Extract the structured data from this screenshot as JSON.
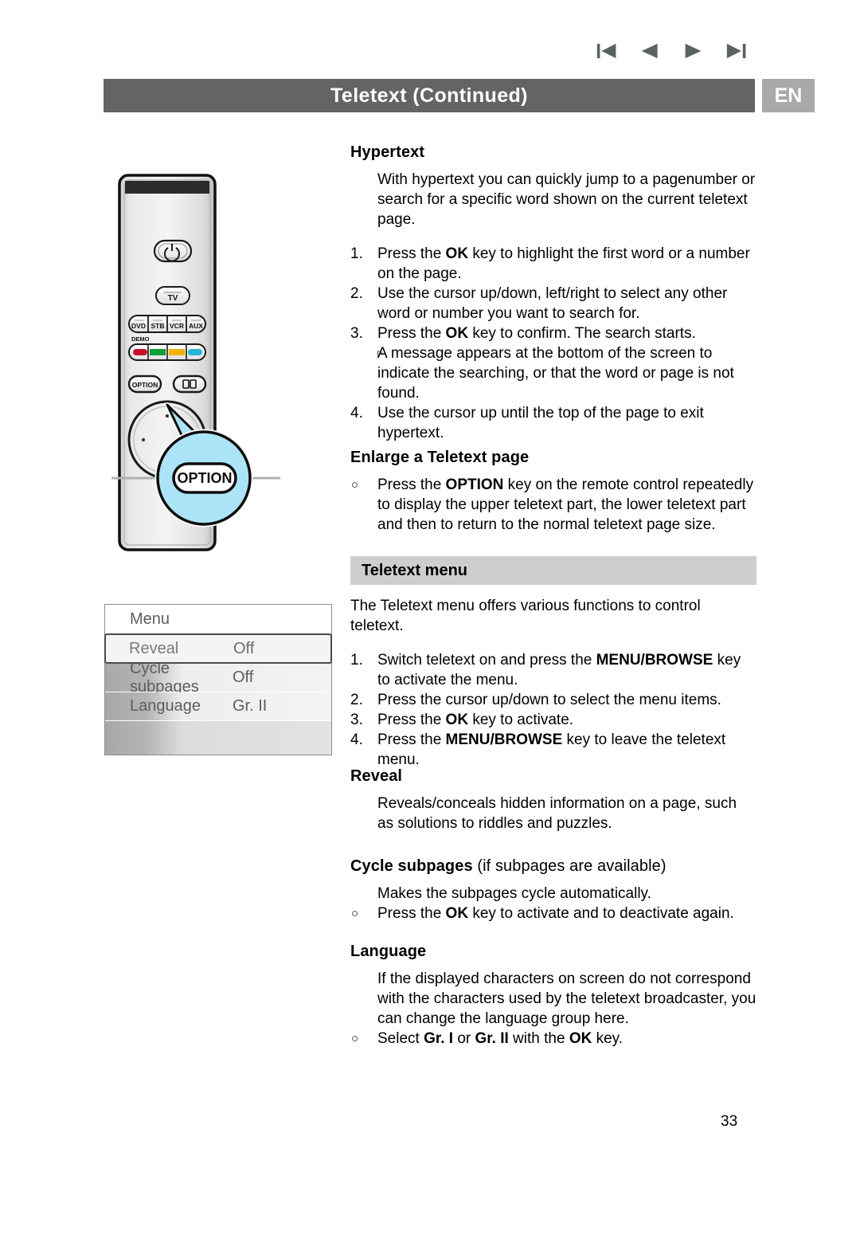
{
  "header": {
    "title": "Teletext  (Continued)",
    "language_badge": "EN",
    "nav_icons": [
      "skip-to-start-icon",
      "previous-icon",
      "next-icon",
      "skip-to-end-icon"
    ],
    "bar_color": "#646464",
    "badge_color": "#a9a9a9"
  },
  "remote": {
    "power_button": "power-icon",
    "tv_button": "TV",
    "device_buttons": [
      "DVD",
      "STB",
      "VCR",
      "AUX"
    ],
    "demo_label": "DEMO",
    "color_keys": [
      "#c8102e",
      "#0a9c3d",
      "#f2b200",
      "#23b5d3"
    ],
    "option_button": "OPTION",
    "guide_button": "book-icon",
    "callout_label": "OPTION",
    "callout_color": "#ace3f7"
  },
  "tv_menu": {
    "title": "Menu",
    "rows": [
      {
        "label": "Reveal",
        "value": "Off",
        "selected": true
      },
      {
        "label": "Cycle subpages",
        "value": "Off",
        "selected": false
      },
      {
        "label": "Language",
        "value": "Gr. II",
        "selected": false
      }
    ]
  },
  "sections": {
    "hypertext": {
      "heading": "Hypertext",
      "intro": "With hypertext you can quickly jump to a pagenumber or search for a specific word shown on the current teletext page.",
      "steps": [
        {
          "num": "1.",
          "pre": "Press the ",
          "key": "OK",
          "post": " key to highlight the first word or a number on the page."
        },
        {
          "num": "2.",
          "pre": "Use the cursor up/down, left/right to select any other word or number you want to search for.",
          "key": "",
          "post": ""
        },
        {
          "num": "3.",
          "pre": "Press the ",
          "key": "OK",
          "post": " key to confirm. The search starts."
        }
      ],
      "substep": {
        "bullet": "▹",
        "text": "A message appears at the bottom of the screen to indicate the searching, or that the word or page is not found."
      },
      "step4": {
        "num": "4.",
        "text": "Use the cursor up until the top of the page to exit hypertext."
      }
    },
    "enlarge": {
      "heading": "Enlarge a Teletext page",
      "bullet": "○",
      "pre": "Press the ",
      "key": "OPTION",
      "post": " key on the remote control repeatedly to display the upper teletext part, the lower teletext part and then to return to the normal teletext page size."
    },
    "teletext_menu": {
      "band_heading": "Teletext menu",
      "intro": "The Teletext menu offers various functions to control teletext.",
      "steps": [
        {
          "num": "1.",
          "pre": "Switch teletext on and press the ",
          "key": "MENU/BROWSE",
          "post": " key to activate the menu."
        },
        {
          "num": "2.",
          "pre": "Press the cursor up/down to select the menu items.",
          "key": "",
          "post": ""
        },
        {
          "num": "3.",
          "pre": "Press the ",
          "key": "OK",
          "post": " key to activate."
        },
        {
          "num": "4.",
          "pre": "Press the ",
          "key": "MENU/BROWSE",
          "post": " key to leave the teletext menu."
        }
      ]
    },
    "reveal": {
      "heading": "Reveal",
      "body": "Reveals/conceals hidden information on a page, such as solutions to riddles and puzzles."
    },
    "cycle_subpages": {
      "heading_bold": "Cycle subpages",
      "heading_rest": " (if subpages are available)",
      "body": "Makes the subpages cycle automatically.",
      "bullet": "○",
      "bullet_pre": "Press the ",
      "bullet_key": "OK",
      "bullet_post": " key to activate and to deactivate again."
    },
    "language": {
      "heading": "Language",
      "body": "If the displayed characters on screen do not correspond with the characters used by the teletext broadcaster, you can change the language group here.",
      "bullet": "○",
      "bullet_pre": "Select ",
      "bullet_key1": "Gr. I",
      "bullet_mid": " or ",
      "bullet_key2": "Gr. II",
      "bullet_mid2": " with the ",
      "bullet_key3": "OK",
      "bullet_post": " key."
    }
  },
  "footer": {
    "page_number": "33"
  }
}
